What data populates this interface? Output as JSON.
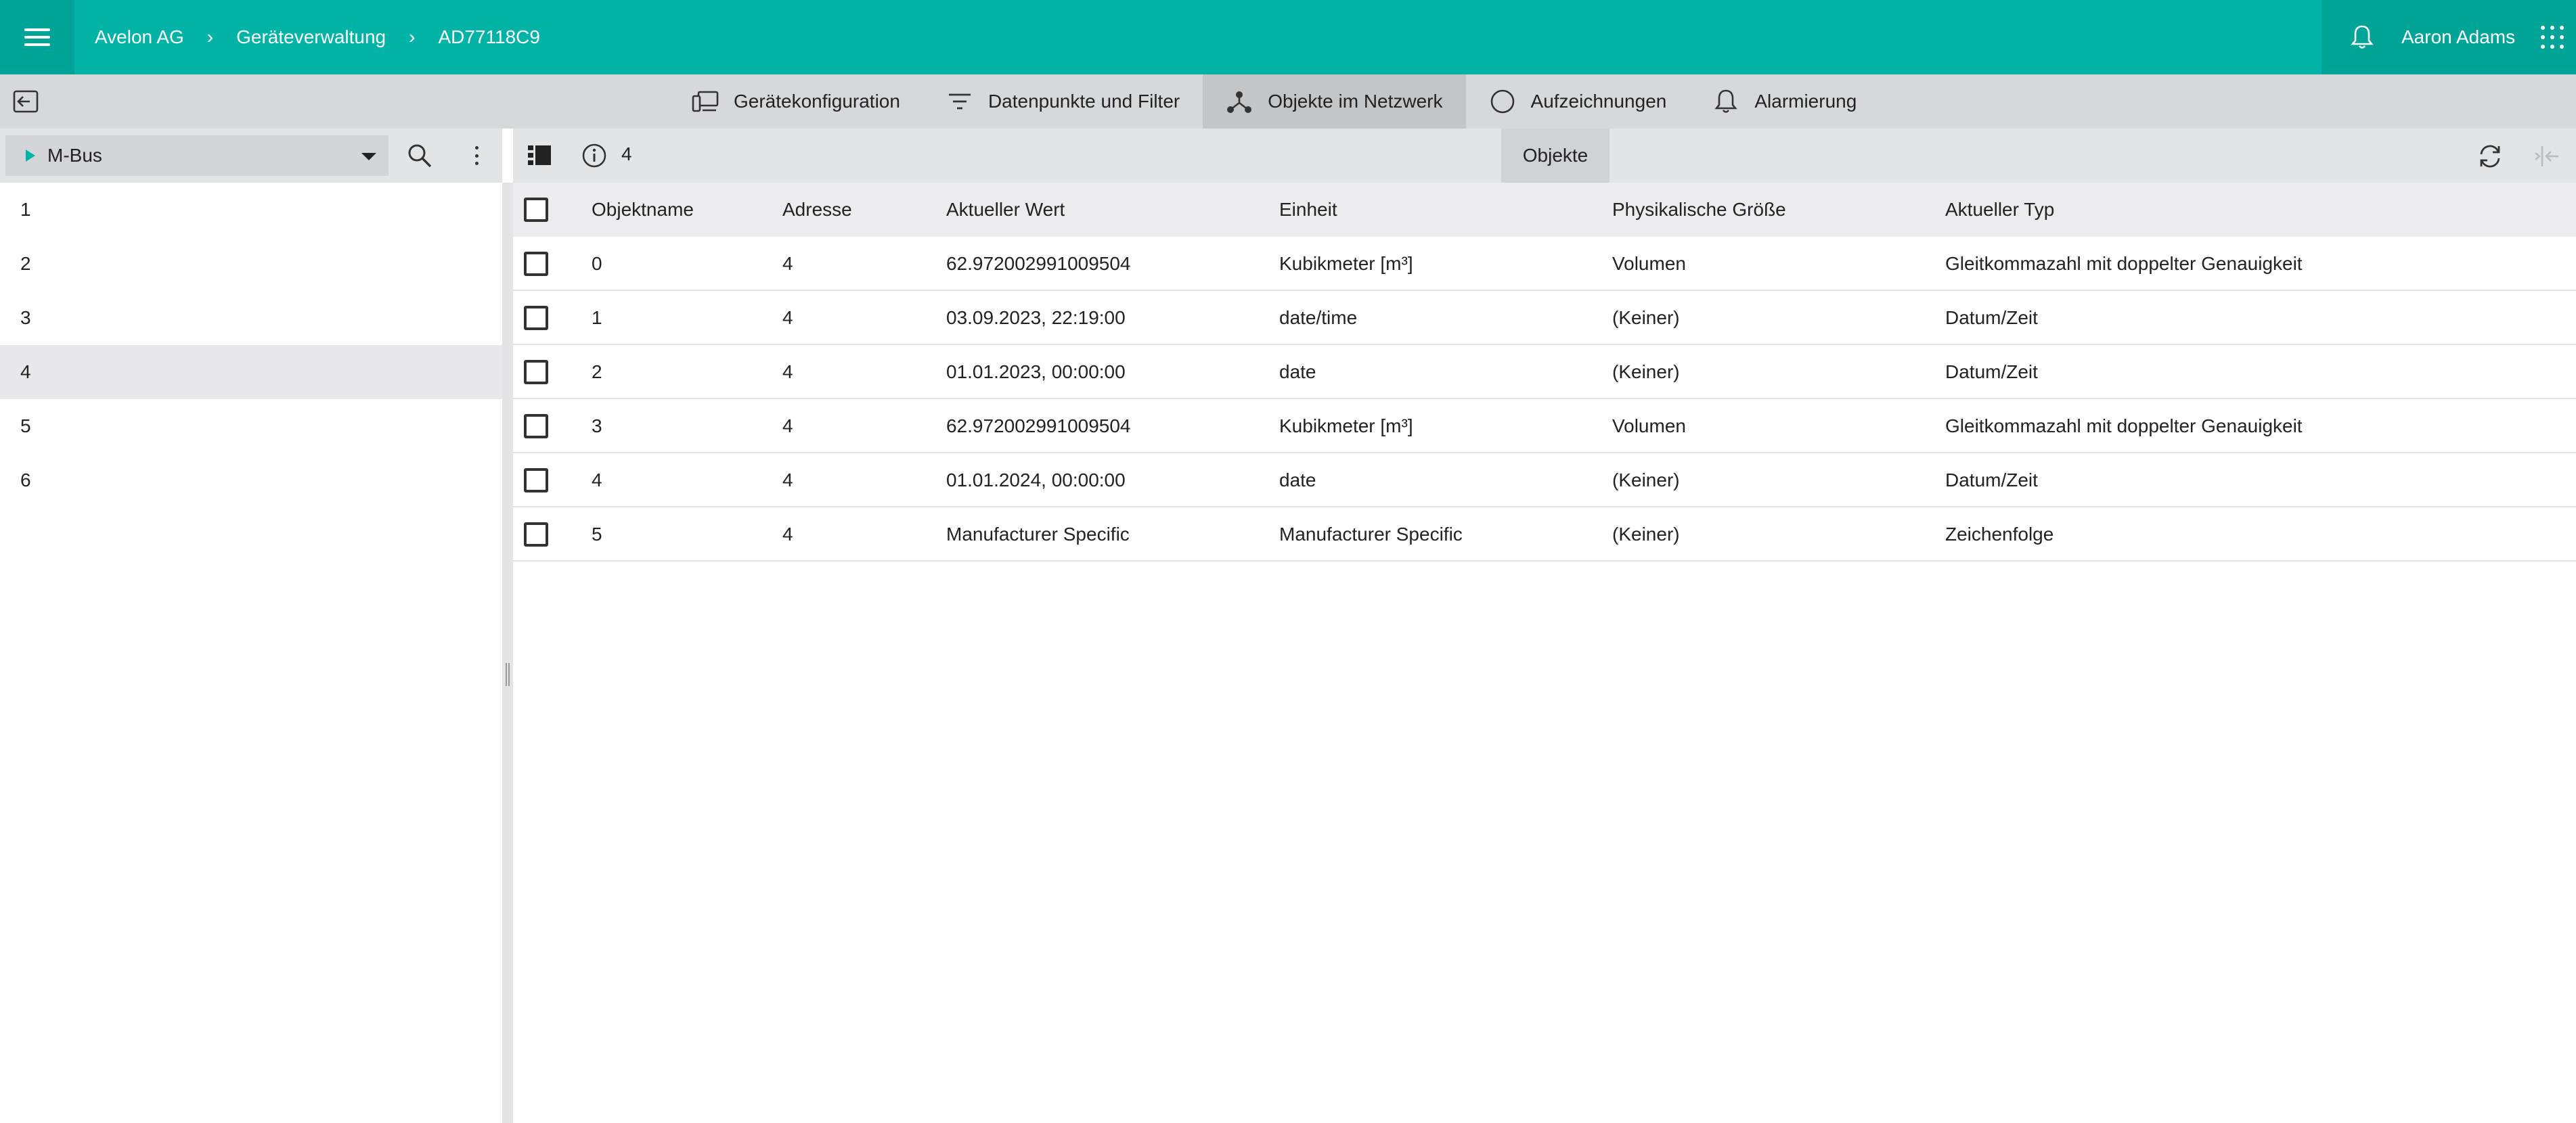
{
  "header": {
    "breadcrumb": [
      "Avelon AG",
      "Geräteverwaltung",
      "AD77118C9"
    ],
    "separator": "›",
    "user_name": "Aaron Adams"
  },
  "tabs": [
    {
      "label": "Gerätekonfiguration",
      "icon": "devices-icon",
      "active": false
    },
    {
      "label": "Datenpunkte und Filter",
      "icon": "filter-icon",
      "active": false
    },
    {
      "label": "Objekte im Netzwerk",
      "icon": "network-icon",
      "active": true
    },
    {
      "label": "Aufzeichnungen",
      "icon": "circle-icon",
      "active": false
    },
    {
      "label": "Alarmierung",
      "icon": "bell-icon",
      "active": false
    }
  ],
  "left_panel": {
    "select_value": "M-Bus",
    "items": [
      "1",
      "2",
      "3",
      "4",
      "5",
      "6"
    ],
    "selected_index": 3
  },
  "right_panel": {
    "count": "4",
    "tab_label": "Objekte"
  },
  "table": {
    "columns": [
      "Objektname",
      "Adresse",
      "Aktueller Wert",
      "Einheit",
      "Physikalische Größe",
      "Aktueller Typ"
    ],
    "rows": [
      [
        "0",
        "4",
        "62.972002991009504",
        "Kubikmeter [m³]",
        "Volumen",
        "Gleitkommazahl mit doppelter Genauigkeit"
      ],
      [
        "1",
        "4",
        "03.09.2023, 22:19:00",
        "date/time",
        "(Keiner)",
        "Datum/Zeit"
      ],
      [
        "2",
        "4",
        "01.01.2023, 00:00:00",
        "date",
        "(Keiner)",
        "Datum/Zeit"
      ],
      [
        "3",
        "4",
        "62.972002991009504",
        "Kubikmeter [m³]",
        "Volumen",
        "Gleitkommazahl mit doppelter Genauigkeit"
      ],
      [
        "4",
        "4",
        "01.01.2024, 00:00:00",
        "date",
        "(Keiner)",
        "Datum/Zeit"
      ],
      [
        "5",
        "4",
        "Manufacturer Specific",
        "Manufacturer Specific",
        "(Keiner)",
        "Zeichenfolge"
      ]
    ]
  },
  "colors": {
    "brand": "#00b3a6",
    "brand_dark": "#00a497"
  }
}
